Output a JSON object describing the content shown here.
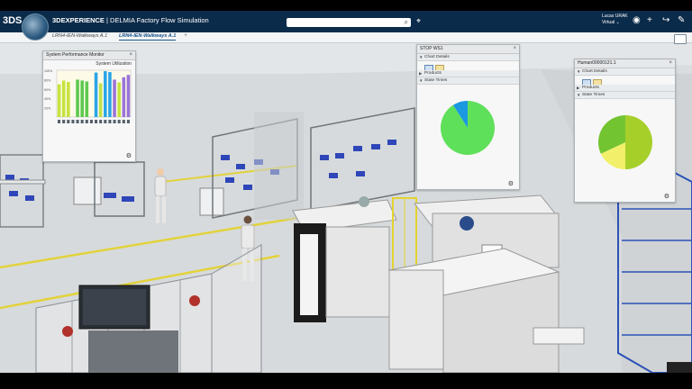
{
  "app": {
    "brand_logo": "3DS",
    "title_bold": "3DEXPERIENCE",
    "title_rest": " | DELMIA Factory Flow Simulation",
    "search_placeholder": "",
    "user_name": "Lucas URAK",
    "user_sub": "Virtual ⌄"
  },
  "tabs": [
    {
      "label": "LRN4-IEN-Walkways A.1"
    },
    {
      "label": "LRN4-IEN-Walkways A.1"
    }
  ],
  "perf_monitor": {
    "title": "System Performance Monitor",
    "chart_label": "System Utilization",
    "tick_labels": [
      "100%",
      "80%",
      "60%",
      "40%",
      "20%"
    ]
  },
  "stop_window": {
    "title": "STOP WS1",
    "section_chart": "Chart Details",
    "section_products": "Products",
    "section_states": "State Times"
  },
  "human_window": {
    "title": "Human00000121.1",
    "section_chart": "Chart Details",
    "section_products": "Products",
    "section_states": "State Times"
  },
  "colors": {
    "header": "#0b2b4a",
    "accent": "#17538a",
    "pie_green": "#5fe05a",
    "pie_blue": "#1b98e0",
    "pie_lime": "#a6cf2a",
    "pie_yellow": "#f2f06a",
    "pie_mid": "#73c431"
  },
  "icons": {
    "search": "magnifier",
    "tag": "tag",
    "add": "plus",
    "share": "share-arrow",
    "tools": "wrench",
    "compass": "compass"
  },
  "chart_data": [
    {
      "type": "bar",
      "title": "System Utilization",
      "ylim": [
        0,
        100
      ],
      "categories": [
        "1",
        "2",
        "3",
        "4",
        "5",
        "6",
        "7",
        "8",
        "9",
        "10",
        "11",
        "12",
        "13",
        "14",
        "15",
        "16"
      ],
      "series": [
        {
          "values": [
            70,
            78,
            75,
            0,
            80,
            78,
            76,
            0,
            95,
            72,
            98,
            96,
            80,
            74,
            85,
            90
          ]
        }
      ]
    },
    {
      "type": "pie",
      "title": "",
      "values": [
        91,
        9
      ],
      "slice_colors": [
        "#5fe05a",
        "#1b98e0"
      ]
    },
    {
      "type": "pie",
      "title": "",
      "values": [
        50,
        18,
        32
      ],
      "slice_colors": [
        "#a6cf2a",
        "#f2f06a",
        "#73c431"
      ]
    }
  ]
}
